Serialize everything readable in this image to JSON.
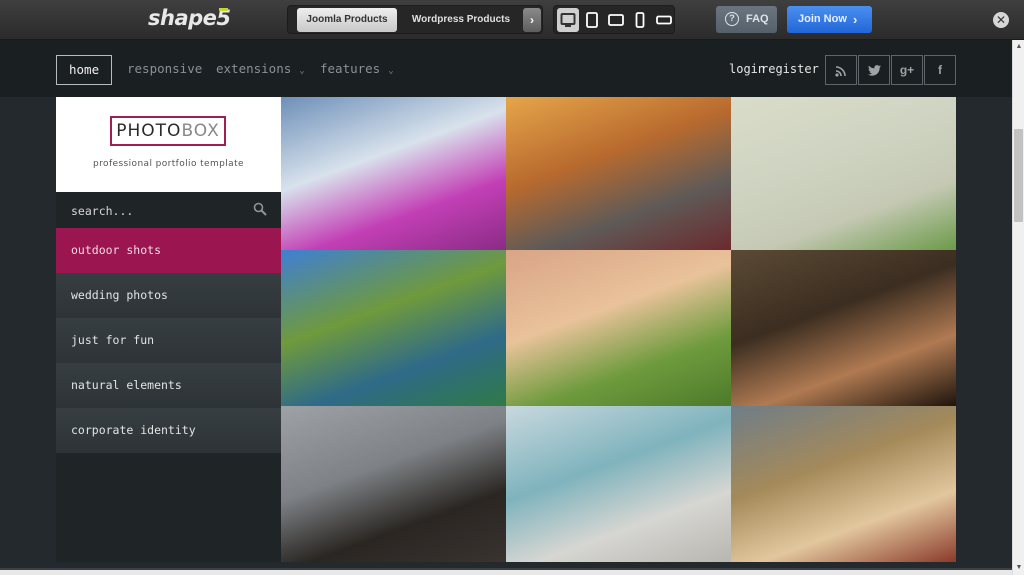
{
  "topbar": {
    "brand_main": "shape",
    "brand_accent": "5",
    "products": [
      {
        "label": "Joomla Products",
        "active": true
      },
      {
        "label": "Wordpress Products",
        "active": false
      }
    ],
    "next_glyph": "›",
    "devices": [
      {
        "name": "desktop",
        "active": true
      },
      {
        "name": "tablet-portrait",
        "active": false
      },
      {
        "name": "tablet-landscape",
        "active": false
      },
      {
        "name": "phone-portrait",
        "active": false
      },
      {
        "name": "phone-landscape",
        "active": false
      }
    ],
    "faq_glyph": "?",
    "faq_label": "FAQ",
    "join_label": "Join Now",
    "join_glyph": "›",
    "close_glyph": "✕"
  },
  "nav": {
    "items": [
      {
        "label": "home",
        "active": true,
        "dropdown": false
      },
      {
        "label": "responsive",
        "active": false,
        "dropdown": false
      },
      {
        "label": "extensions",
        "active": false,
        "dropdown": true
      },
      {
        "label": "features",
        "active": false,
        "dropdown": true
      }
    ],
    "caret_glyph": "⌄",
    "login": "login",
    "register": "register",
    "social": [
      {
        "name": "rss",
        "glyph": "◝"
      },
      {
        "name": "twitter",
        "glyph": "t"
      },
      {
        "name": "google-plus",
        "glyph": "g+"
      },
      {
        "name": "facebook",
        "glyph": "f"
      }
    ]
  },
  "sidebar": {
    "logo_dark": "PHOTO",
    "logo_light": "BOX",
    "tagline": "professional portfolio template",
    "search_placeholder": "search...",
    "categories": [
      {
        "label": "outdoor shots",
        "active": true
      },
      {
        "label": "wedding photos",
        "active": false
      },
      {
        "label": "just for fun",
        "active": false
      },
      {
        "label": "natural elements",
        "active": false
      },
      {
        "label": "corporate identity",
        "active": false
      }
    ]
  },
  "gallery": {
    "photos": [
      {
        "subject": "pink tree in magenta field under cloudy sky",
        "colors": [
          "#6d8fb8",
          "#d8e2ec",
          "#c23fb5",
          "#8a2c86"
        ]
      },
      {
        "subject": "woman in tweed coat with autumn bokeh",
        "colors": [
          "#e6a54a",
          "#b86a2e",
          "#5f5a57",
          "#6b2a2e"
        ]
      },
      {
        "subject": "flying house tethered to a tree",
        "colors": [
          "#d9dcc8",
          "#cfd4c2",
          "#c5c9b4",
          "#6c9a4a"
        ]
      },
      {
        "subject": "colorful boats on mountain lake",
        "colors": [
          "#3f7fd4",
          "#6f9a3c",
          "#2f6a88",
          "#2f7a48"
        ]
      },
      {
        "subject": "boy watching hot air balloons over green field",
        "colors": [
          "#d9a487",
          "#e9c29a",
          "#6f9b3e",
          "#4d7a2a"
        ]
      },
      {
        "subject": "woman with golden headpiece",
        "colors": [
          "#5c4a35",
          "#3b2d20",
          "#b07a52",
          "#1e140c"
        ]
      },
      {
        "subject": "woman in dark feather costume with red face paint",
        "colors": [
          "#9ea2a6",
          "#7e8286",
          "#2a2622",
          "#3a3330"
        ]
      },
      {
        "subject": "pelicans on wooden pier by the sea",
        "colors": [
          "#c9d8de",
          "#7fb3bd",
          "#d6d6d2",
          "#b8b6b0"
        ]
      },
      {
        "subject": "rhino on beach with cliffs",
        "colors": [
          "#6f7d88",
          "#a58a5a",
          "#e2c79e",
          "#8a3a2a"
        ]
      }
    ]
  },
  "scrollbar": {
    "up_glyph": "▲",
    "down_glyph": "▼",
    "position_fraction": 0.18
  }
}
